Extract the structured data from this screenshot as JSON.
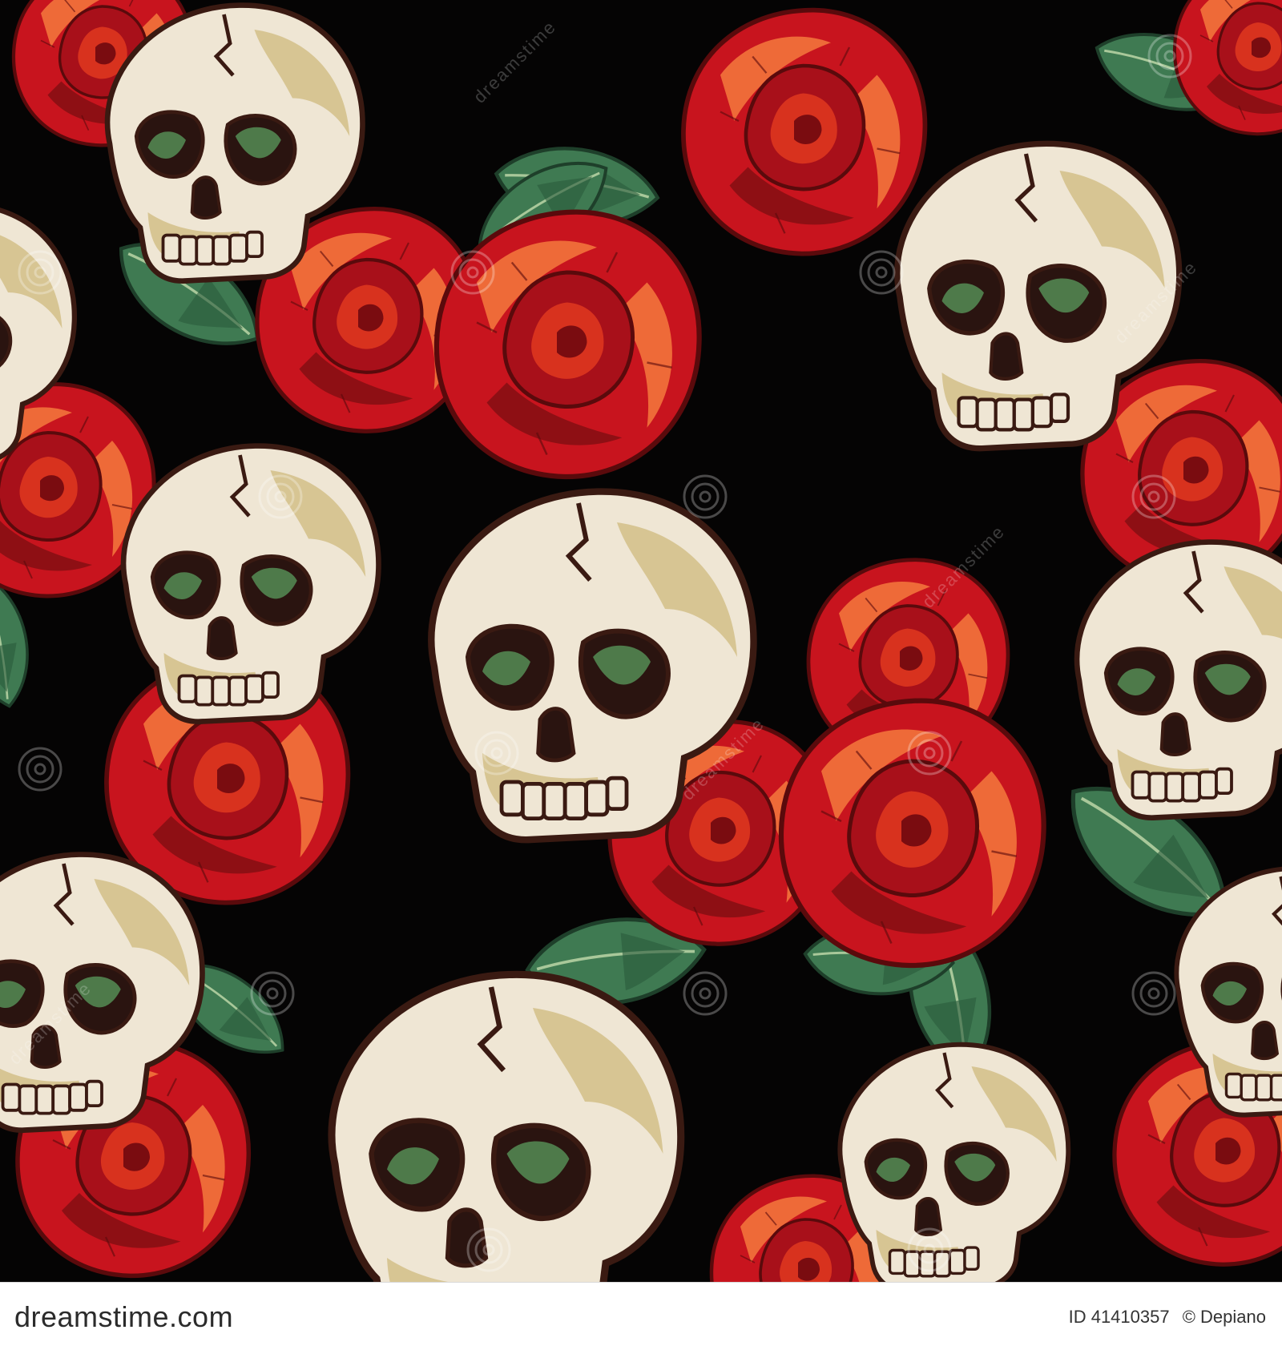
{
  "image": {
    "description_colors": {
      "background": "#050404",
      "bone": "#efe6d4",
      "bone_shadow": "#d7c593",
      "outline": "#3a1a12",
      "eye_green": "#4e7a4a",
      "rose_red": "#c8141e",
      "rose_dark": "#8e0f14",
      "rose_orange": "#ee6a38",
      "leaf": "#3f7a52",
      "leaf_dark": "#2a5a3c"
    }
  },
  "watermark": {
    "text": "dreamstime"
  },
  "footer": {
    "brand": "dreamstime.com",
    "id_label": "ID 41410357",
    "credit": "© Depiano"
  }
}
